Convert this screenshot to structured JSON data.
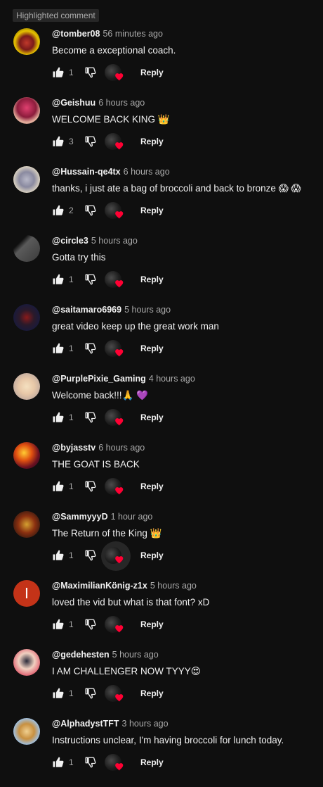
{
  "header": {
    "highlight_label": "Highlighted comment"
  },
  "reply_label": "Reply",
  "colors": {
    "background": "#0f0f0f",
    "text": "#f1f1f1",
    "muted": "#aaaaaa",
    "heart": "#ff0033"
  },
  "icons": {
    "like": "thumb-up-icon",
    "dislike": "thumb-down-icon",
    "creator_heart": "heart-icon"
  },
  "comments": [
    {
      "author": "@tomber08",
      "time": "56 minutes ago",
      "text": "Become a exceptional coach.",
      "likes": "1"
    },
    {
      "author": "@Geishuu",
      "time": "6 hours ago",
      "text": "WELCOME BACK KING 👑",
      "likes": "3"
    },
    {
      "author": "@Hussain-qe4tx",
      "time": "6 hours ago",
      "text": "thanks, i just ate a bag of broccoli and back to bronze 😱 😱",
      "likes": "2"
    },
    {
      "author": "@circle3",
      "time": "5 hours ago",
      "text": "Gotta try this",
      "likes": "1"
    },
    {
      "author": "@saitamaro6969",
      "time": "5 hours ago",
      "text": "great video keep up the great work man",
      "likes": "1"
    },
    {
      "author": "@PurplePixie_Gaming",
      "time": "4 hours ago",
      "text": "Welcome back!!!🙏 💜",
      "likes": "1"
    },
    {
      "author": "@byjasstv",
      "time": "6 hours ago",
      "text": "THE GOAT IS BACK",
      "likes": "1"
    },
    {
      "author": "@SammyyyD",
      "time": "1 hour ago",
      "text": "The Return of the King 👑",
      "likes": "1"
    },
    {
      "author": "@MaximilianKönig-z1x",
      "time": "5 hours ago",
      "text": "loved the vid but what is that font? xD",
      "likes": "1",
      "avatar_letter": "I"
    },
    {
      "author": "@gedehesten",
      "time": "5 hours ago",
      "text": "I AM CHALLENGER NOW TYYY😍",
      "likes": "1"
    },
    {
      "author": "@AlphadystTFT",
      "time": "3 hours ago",
      "text": "Instructions unclear, I'm having broccoli for lunch today.",
      "likes": "1"
    }
  ]
}
